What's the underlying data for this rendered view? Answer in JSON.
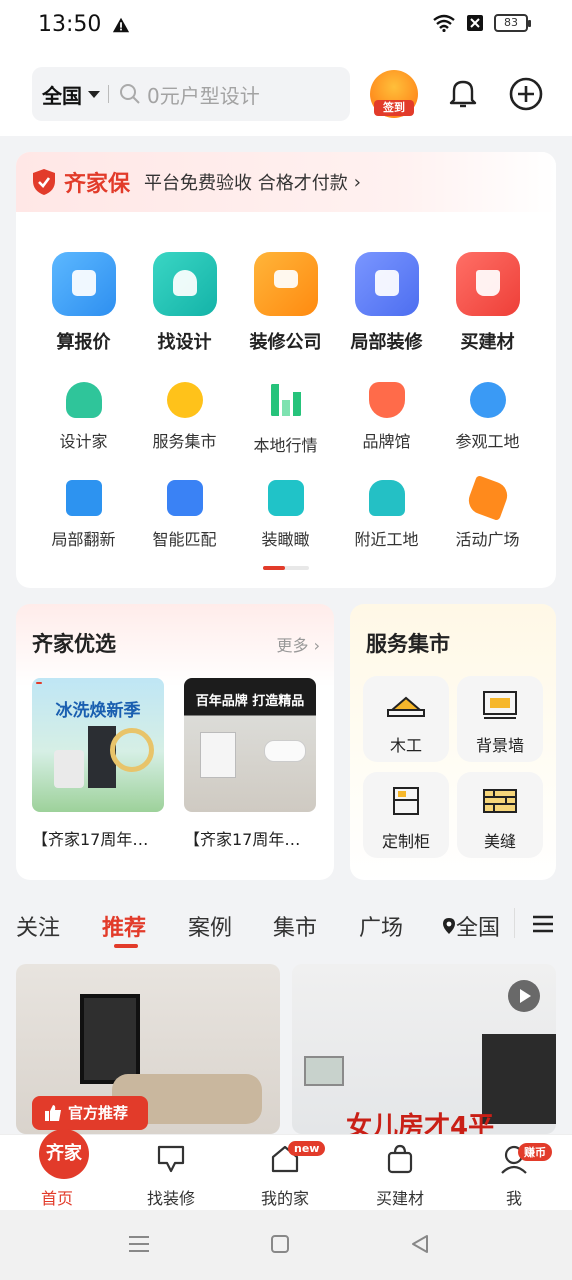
{
  "status": {
    "time": "13:50",
    "battery": "83"
  },
  "topbar": {
    "city": "全国",
    "search_placeholder": "0元户型设计",
    "sign_label": "签到"
  },
  "guarantee": {
    "title": "齐家保",
    "text": "平台免费验收 合格才付款",
    "arrow": "›"
  },
  "big_services": [
    {
      "label": "算报价",
      "color": "#3ea5f5"
    },
    {
      "label": "找设计",
      "color": "#22c4b4"
    },
    {
      "label": "装修公司",
      "color": "#ff9a1a"
    },
    {
      "label": "局部装修",
      "color": "#5b7cf6"
    },
    {
      "label": "买建材",
      "color": "#f2504a"
    }
  ],
  "small_services_row1": [
    {
      "label": "设计家",
      "color": "#2fc59a"
    },
    {
      "label": "服务集市",
      "color": "#ffc21a"
    },
    {
      "label": "本地行情",
      "color": "#26c37b"
    },
    {
      "label": "品牌馆",
      "color": "#ff6b4a"
    },
    {
      "label": "参观工地",
      "color": "#3a9af5"
    }
  ],
  "small_services_row2": [
    {
      "label": "局部翻新",
      "color": "#2d93f0"
    },
    {
      "label": "智能匹配",
      "color": "#3a82f5"
    },
    {
      "label": "装瞰瞰",
      "color": "#20c3c8"
    },
    {
      "label": "附近工地",
      "color": "#24c0c5"
    },
    {
      "label": "活动广场",
      "color": "#ff8a1c"
    }
  ],
  "selection": {
    "title": "齐家优选",
    "more": "更多 ›",
    "products": [
      {
        "promo": "冰洗焕新季",
        "name": "【齐家17周年…"
      },
      {
        "promo": "百年品牌 打造精品",
        "name": "【齐家17周年…"
      }
    ]
  },
  "service_market": {
    "title": "服务集市",
    "items": [
      {
        "label": "木工"
      },
      {
        "label": "背景墙"
      },
      {
        "label": "定制柜"
      },
      {
        "label": "美缝"
      }
    ]
  },
  "tabs": [
    {
      "label": "关注"
    },
    {
      "label": "推荐"
    },
    {
      "label": "案例"
    },
    {
      "label": "集市"
    },
    {
      "label": "广场"
    }
  ],
  "tab_location": "全国",
  "feed": [
    {
      "badge": "官方推荐"
    },
    {
      "title": "女儿房才4平"
    }
  ],
  "bottom_nav": {
    "home_logo": "齐家",
    "items": [
      {
        "label": "首页"
      },
      {
        "label": "找装修"
      },
      {
        "label": "我的家",
        "badge": "new"
      },
      {
        "label": "买建材"
      },
      {
        "label": "我",
        "badge": "赚币"
      }
    ]
  }
}
